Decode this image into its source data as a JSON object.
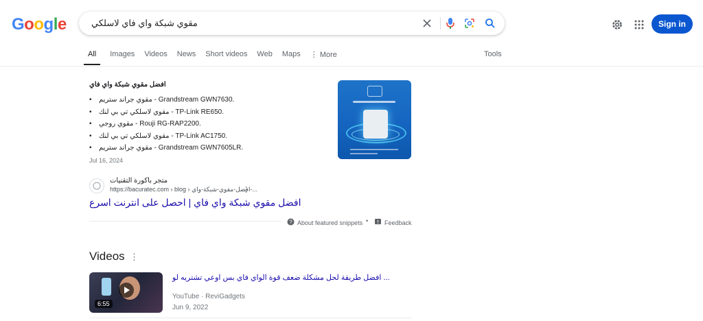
{
  "logo": {
    "letters": [
      "G",
      "o",
      "o",
      "g",
      "l",
      "e"
    ],
    "colors": [
      "#4285f4",
      "#ea4335",
      "#fbbc05",
      "#4285f4",
      "#34a853",
      "#ea4335"
    ]
  },
  "search": {
    "query": "مقوي شبكة واي فاي لاسلكي"
  },
  "header": {
    "sign_in": "Sign in"
  },
  "tabs": [
    "All",
    "Images",
    "Videos",
    "News",
    "Short videos",
    "Web",
    "Maps",
    "More"
  ],
  "tools": "Tools",
  "featured_snippet": {
    "title": "افضل مقوي شبكة واي فاي",
    "items": [
      "مقوي جراند ستريم - Grandstream GWN7630.",
      "مقوي لاسلكي تي بي لنك - TP-Link RE650.",
      "مقوي روجي - Rouji RG-RAP2200.",
      "مقوي لاسلكي تي بي لنك - TP-Link AC1750.",
      "مقوي جراند ستريم - Grandstream GWN7605LR."
    ],
    "date": "Jul 16, 2024",
    "source_name": "متجر باكورة التقنيات",
    "source_url": "https://bacuratec.com › blog › افضل-مقوي-شبكة-واي-...",
    "link_title": "افضل مقوي شبكة واي فاي | احصل على انترنت اسرع",
    "about": "About featured snippets",
    "feedback": "Feedback"
  },
  "videos": {
    "heading": "Videos",
    "items": [
      {
        "title": "افضل طريقة لحل مشكلة ضعف قوة الواي فاي بس اوعي تشتريه لو ...",
        "source": "YouTube · ReviGadgets",
        "date": "Jun 9, 2022",
        "duration": "6:55"
      }
    ]
  }
}
